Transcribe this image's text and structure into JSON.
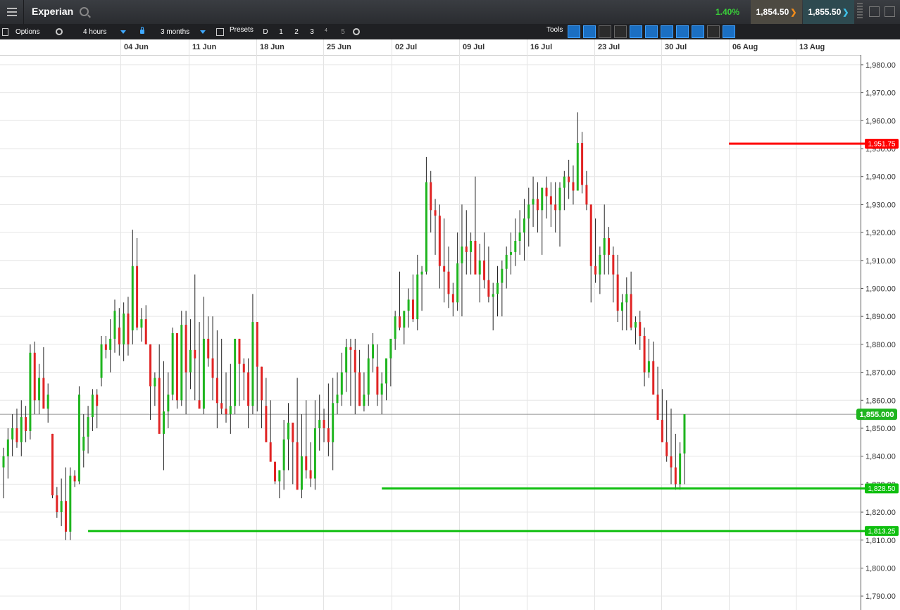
{
  "app": {
    "title": "Experian",
    "change": "1.40%",
    "sell_price": "1,854.50",
    "buy_price": "1,855.50"
  },
  "toolbar": {
    "options_label": "Options",
    "interval": "4 hours",
    "range": "3 months",
    "presets_label": "Presets",
    "preset_buttons": [
      "D",
      "1",
      "2",
      "3",
      "4",
      "5"
    ],
    "tools_label": "Tools"
  },
  "colors": {
    "up": "#1fb51f",
    "down": "#e02424",
    "resistance": "#ff0000",
    "support": "#0fbf0f",
    "accent": "#3ea0ff"
  },
  "chart_data": {
    "type": "candlestick",
    "instrument": "Experian",
    "interval": "4 hours",
    "x_tick_labels": [
      "04 Jun",
      "11 Jun",
      "18 Jun",
      "25 Jun",
      "02 Jul",
      "09 Jul",
      "16 Jul",
      "23 Jul",
      "30 Jul",
      "06 Aug",
      "13 Aug"
    ],
    "y_tick_labels": [
      "1,980.00",
      "1,970.00",
      "1,960.00",
      "1,950.00",
      "1,940.00",
      "1,930.00",
      "1,920.00",
      "1,910.00",
      "1,900.00",
      "1,890.00",
      "1,880.00",
      "1,870.00",
      "1,860.00",
      "1,850.00",
      "1,840.00",
      "1,830.00",
      "1,820.00",
      "1,810.00",
      "1,800.00",
      "1,790.00"
    ],
    "ylim": [
      1785,
      1983
    ],
    "current_price": {
      "value": 1855.0,
      "label": "1,855.000"
    },
    "horizontal_lines": [
      {
        "value": 1951.75,
        "label": "1,951.75",
        "color": "resistance",
        "start_bar": 163
      },
      {
        "value": 1828.5,
        "label": "1,828.50",
        "color": "support",
        "start_bar": 85
      },
      {
        "value": 1813.25,
        "label": "1,813.25",
        "color": "support",
        "start_bar": 19
      }
    ],
    "candles": [
      [
        1836,
        1843,
        1825,
        1840
      ],
      [
        1840,
        1850,
        1832,
        1846
      ],
      [
        1846,
        1855,
        1840,
        1850
      ],
      [
        1850,
        1857,
        1843,
        1845
      ],
      [
        1845,
        1860,
        1840,
        1854
      ],
      [
        1854,
        1858,
        1845,
        1849
      ],
      [
        1849,
        1880,
        1846,
        1877
      ],
      [
        1877,
        1881,
        1855,
        1860
      ],
      [
        1860,
        1873,
        1855,
        1868
      ],
      [
        1868,
        1879,
        1858,
        1857
      ],
      [
        1857,
        1866,
        1852,
        1862
      ],
      [
        1848,
        1848,
        1825,
        1826
      ],
      [
        1826,
        1829,
        1818,
        1820
      ],
      [
        1820,
        1832,
        1815,
        1824
      ],
      [
        1824,
        1836,
        1810,
        1813
      ],
      [
        1813,
        1836,
        1810,
        1833
      ],
      [
        1833,
        1835,
        1829,
        1831
      ],
      [
        1831,
        1865,
        1830,
        1862
      ],
      [
        1842,
        1855,
        1836,
        1847
      ],
      [
        1847,
        1858,
        1841,
        1854
      ],
      [
        1854,
        1864,
        1849,
        1862
      ],
      [
        1862,
        1864,
        1850,
        1858
      ],
      [
        1868,
        1883,
        1865,
        1880
      ],
      [
        1880,
        1883,
        1875,
        1878
      ],
      [
        1878,
        1889,
        1870,
        1882
      ],
      [
        1882,
        1896,
        1877,
        1892
      ],
      [
        1886,
        1893,
        1876,
        1880
      ],
      [
        1880,
        1895,
        1874,
        1891
      ],
      [
        1891,
        1897,
        1876,
        1880
      ],
      [
        1885,
        1921,
        1880,
        1908
      ],
      [
        1908,
        1918,
        1885,
        1886
      ],
      [
        1886,
        1893,
        1881,
        1889
      ],
      [
        1889,
        1894,
        1884,
        1880
      ],
      [
        1880,
        1880,
        1853,
        1865
      ],
      [
        1865,
        1870,
        1858,
        1868
      ],
      [
        1868,
        1880,
        1850,
        1848
      ],
      [
        1848,
        1874,
        1835,
        1856
      ],
      [
        1856,
        1870,
        1850,
        1862
      ],
      [
        1862,
        1886,
        1860,
        1884
      ],
      [
        1884,
        1884,
        1857,
        1860
      ],
      [
        1860,
        1892,
        1858,
        1887
      ],
      [
        1887,
        1892,
        1855,
        1870
      ],
      [
        1870,
        1889,
        1864,
        1878
      ],
      [
        1878,
        1905,
        1860,
        1875
      ],
      [
        1860,
        1888,
        1858,
        1857
      ],
      [
        1857,
        1897,
        1855,
        1882
      ],
      [
        1882,
        1890,
        1872,
        1875
      ],
      [
        1875,
        1890,
        1860,
        1868
      ],
      [
        1868,
        1885,
        1850,
        1859
      ],
      [
        1859,
        1882,
        1855,
        1857
      ],
      [
        1857,
        1870,
        1852,
        1855
      ],
      [
        1855,
        1873,
        1848,
        1858
      ],
      [
        1858,
        1880,
        1855,
        1882
      ],
      [
        1882,
        1882,
        1858,
        1873
      ],
      [
        1873,
        1875,
        1860,
        1870
      ],
      [
        1870,
        1875,
        1850,
        1858
      ],
      [
        1858,
        1898,
        1855,
        1888
      ],
      [
        1888,
        1888,
        1856,
        1872
      ],
      [
        1872,
        1872,
        1850,
        1860
      ],
      [
        1858,
        1868,
        1850,
        1845
      ],
      [
        1845,
        1860,
        1842,
        1838
      ],
      [
        1838,
        1838,
        1830,
        1831
      ],
      [
        1831,
        1835,
        1825,
        1835
      ],
      [
        1835,
        1853,
        1828,
        1846
      ],
      [
        1846,
        1859,
        1835,
        1852
      ],
      [
        1852,
        1852,
        1830,
        1845
      ],
      [
        1845,
        1868,
        1830,
        1828
      ],
      [
        1828,
        1855,
        1825,
        1840
      ],
      [
        1840,
        1860,
        1832,
        1835
      ],
      [
        1835,
        1845,
        1829,
        1832
      ],
      [
        1832,
        1860,
        1828,
        1850
      ],
      [
        1850,
        1862,
        1842,
        1853
      ],
      [
        1853,
        1857,
        1845,
        1850
      ],
      [
        1850,
        1866,
        1840,
        1845
      ],
      [
        1845,
        1868,
        1835,
        1859
      ],
      [
        1859,
        1870,
        1855,
        1862
      ],
      [
        1862,
        1877,
        1858,
        1870
      ],
      [
        1870,
        1882,
        1863,
        1879
      ],
      [
        1879,
        1882,
        1858,
        1878
      ],
      [
        1878,
        1882,
        1855,
        1870
      ],
      [
        1870,
        1878,
        1858,
        1858
      ],
      [
        1858,
        1870,
        1856,
        1862
      ],
      [
        1862,
        1880,
        1858,
        1875
      ],
      [
        1875,
        1884,
        1870,
        1880
      ],
      [
        1872,
        1880,
        1858,
        1862
      ],
      [
        1862,
        1870,
        1855,
        1866
      ],
      [
        1866,
        1872,
        1860,
        1875
      ],
      [
        1875,
        1880,
        1865,
        1882
      ],
      [
        1882,
        1892,
        1878,
        1890
      ],
      [
        1890,
        1906,
        1885,
        1886
      ],
      [
        1886,
        1890,
        1880,
        1892
      ],
      [
        1892,
        1900,
        1886,
        1896
      ],
      [
        1896,
        1905,
        1888,
        1889
      ],
      [
        1889,
        1912,
        1885,
        1905
      ],
      [
        1905,
        1908,
        1892,
        1906
      ],
      [
        1906,
        1947,
        1905,
        1938
      ],
      [
        1938,
        1942,
        1920,
        1928
      ],
      [
        1928,
        1932,
        1912,
        1926
      ],
      [
        1926,
        1930,
        1900,
        1908
      ],
      [
        1908,
        1925,
        1895,
        1906
      ],
      [
        1906,
        1915,
        1893,
        1898
      ],
      [
        1898,
        1902,
        1890,
        1895
      ],
      [
        1895,
        1920,
        1892,
        1909
      ],
      [
        1909,
        1930,
        1890,
        1915
      ],
      [
        1915,
        1928,
        1905,
        1913
      ],
      [
        1913,
        1920,
        1905,
        1917
      ],
      [
        1917,
        1940,
        1908,
        1905
      ],
      [
        1905,
        1916,
        1895,
        1910
      ],
      [
        1910,
        1920,
        1900,
        1903
      ],
      [
        1903,
        1915,
        1895,
        1897
      ],
      [
        1897,
        1902,
        1885,
        1898
      ],
      [
        1898,
        1908,
        1890,
        1902
      ],
      [
        1902,
        1910,
        1890,
        1907
      ],
      [
        1907,
        1915,
        1900,
        1912
      ],
      [
        1912,
        1920,
        1905,
        1913
      ],
      [
        1913,
        1925,
        1908,
        1917
      ],
      [
        1917,
        1928,
        1912,
        1920
      ],
      [
        1920,
        1932,
        1910,
        1925
      ],
      [
        1925,
        1936,
        1915,
        1930
      ],
      [
        1930,
        1940,
        1922,
        1932
      ],
      [
        1932,
        1938,
        1920,
        1928
      ],
      [
        1928,
        1936,
        1912,
        1936
      ],
      [
        1936,
        1940,
        1925,
        1933
      ],
      [
        1933,
        1938,
        1922,
        1930
      ],
      [
        1930,
        1938,
        1920,
        1928
      ],
      [
        1928,
        1938,
        1915,
        1936
      ],
      [
        1936,
        1942,
        1928,
        1940
      ],
      [
        1940,
        1946,
        1932,
        1938
      ],
      [
        1938,
        1944,
        1930,
        1935
      ],
      [
        1935,
        1963,
        1935,
        1952
      ],
      [
        1952,
        1956,
        1934,
        1937
      ],
      [
        1937,
        1942,
        1928,
        1930
      ],
      [
        1930,
        1930,
        1895,
        1908
      ],
      [
        1908,
        1925,
        1902,
        1905
      ],
      [
        1905,
        1915,
        1898,
        1912
      ],
      [
        1912,
        1930,
        1905,
        1918
      ],
      [
        1918,
        1922,
        1905,
        1912
      ],
      [
        1912,
        1915,
        1895,
        1905
      ],
      [
        1905,
        1912,
        1888,
        1892
      ],
      [
        1892,
        1898,
        1885,
        1895
      ],
      [
        1895,
        1904,
        1885,
        1898
      ],
      [
        1898,
        1906,
        1885,
        1886
      ],
      [
        1886,
        1890,
        1880,
        1888
      ],
      [
        1888,
        1892,
        1878,
        1883
      ],
      [
        1883,
        1886,
        1865,
        1870
      ],
      [
        1870,
        1882,
        1868,
        1874
      ],
      [
        1874,
        1881,
        1865,
        1862
      ],
      [
        1862,
        1872,
        1855,
        1853
      ],
      [
        1853,
        1864,
        1845,
        1845
      ],
      [
        1845,
        1860,
        1838,
        1840
      ],
      [
        1840,
        1857,
        1830,
        1836
      ],
      [
        1836,
        1848,
        1828,
        1830
      ],
      [
        1830,
        1845,
        1828,
        1841
      ],
      [
        1841,
        1855,
        1830,
        1855
      ]
    ]
  }
}
